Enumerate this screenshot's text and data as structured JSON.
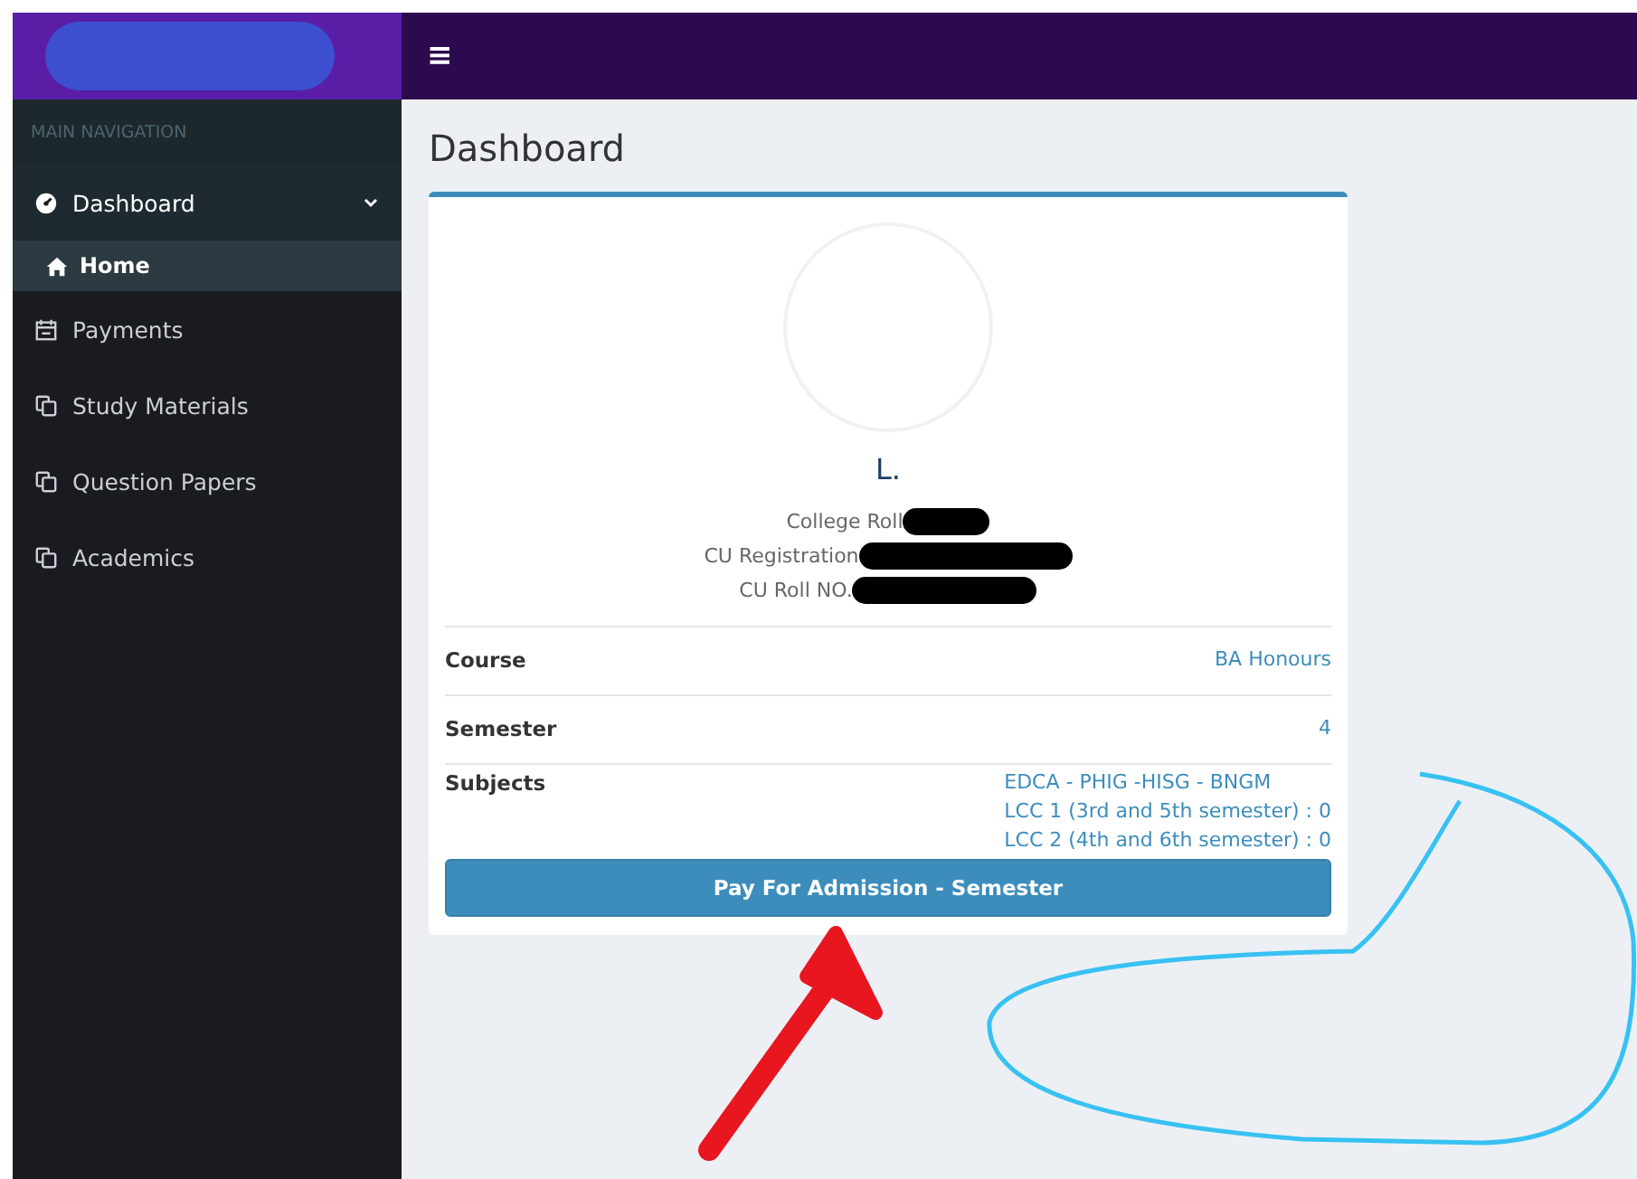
{
  "header": {
    "logo_redacted": true,
    "menu_icon": "≡"
  },
  "sidebar": {
    "heading": "MAIN NAVIGATION",
    "items": [
      {
        "label": "Dashboard",
        "expanded": true,
        "selected": false,
        "children": [
          {
            "label": "Home",
            "selected": true
          }
        ]
      },
      {
        "label": "Payments",
        "selected": false
      },
      {
        "label": "Study Materials",
        "selected": false
      },
      {
        "label": "Question Papers",
        "selected": false
      },
      {
        "label": "Academics",
        "selected": false
      }
    ]
  },
  "page_title": "Dashboard",
  "profile": {
    "name": "L.",
    "ids": [
      {
        "label": "College Roll",
        "redacted": true
      },
      {
        "label": "CU Registration",
        "redacted": true
      },
      {
        "label": "CU Roll NO.",
        "redacted": true
      }
    ]
  },
  "details": [
    {
      "label": "Course",
      "values": [
        "BA Honours"
      ]
    },
    {
      "label": "Semester",
      "values": [
        "4"
      ]
    },
    {
      "label": "Subjects",
      "values": [
        "EDCA - PHIG -HISG - BNGM",
        "LCC 1 (3rd and 5th semester) : 0",
        "LCC 2 (4th and 6th semester) : 0"
      ]
    }
  ],
  "action_button": "Pay For Admission - Semester",
  "annotations": [
    {
      "color": "#e8161f"
    },
    {
      "color": "#38c1f2"
    }
  ]
}
